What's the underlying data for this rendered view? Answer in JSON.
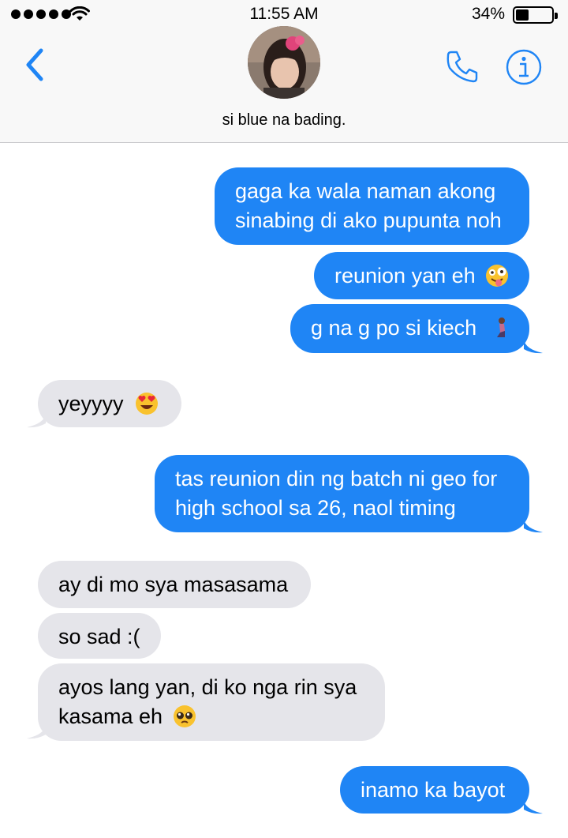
{
  "status": {
    "time": "11:55 AM",
    "battery": "34%"
  },
  "header": {
    "contact_name": "si blue na bading."
  },
  "icons": {
    "back": "chevron-left-icon",
    "phone": "phone-icon",
    "info": "info-icon",
    "accent": "#1f85f5"
  },
  "messages": [
    {
      "dir": "out",
      "lines": [
        "gaga ka wala naman akong",
        "sinabing di ako pupunta noh"
      ]
    },
    {
      "dir": "out",
      "lines": [
        "reunion yan eh"
      ],
      "emoji": "zany-face"
    },
    {
      "dir": "out",
      "lines": [
        "g na g po si kiech"
      ],
      "emoji": "kneeling-person"
    },
    {
      "dir": "in",
      "lines": [
        "yeyyyy"
      ],
      "emoji": "heart-eyes"
    },
    {
      "dir": "out",
      "lines": [
        "tas reunion din ng batch ni geo for",
        "high school sa 26, naol timing"
      ]
    },
    {
      "dir": "in",
      "lines": [
        "ay di mo sya masasama"
      ]
    },
    {
      "dir": "in",
      "lines": [
        "so sad :("
      ]
    },
    {
      "dir": "in",
      "lines": [
        "ayos lang yan, di ko nga rin sya",
        "kasama eh"
      ],
      "emoji": "pleading-face"
    },
    {
      "dir": "out",
      "lines": [
        "inamo ka bayot"
      ]
    }
  ]
}
